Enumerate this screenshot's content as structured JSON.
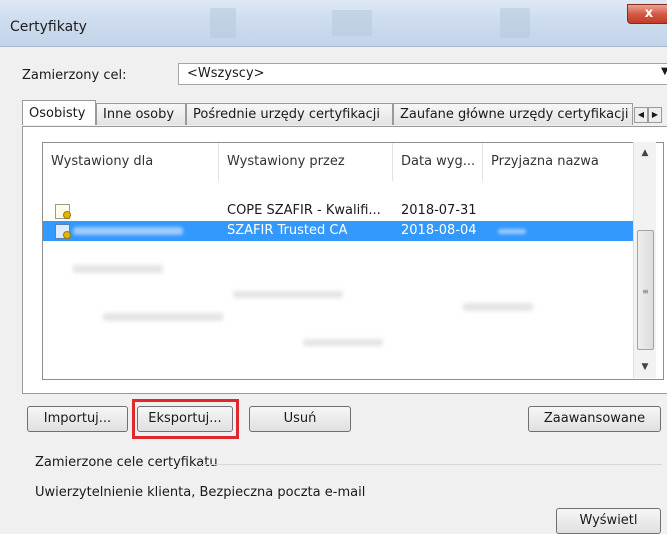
{
  "window": {
    "title": "Certyfikaty",
    "close_glyph": "x"
  },
  "purpose": {
    "label": "Zamierzony cel:",
    "value": "<Wszyscy>"
  },
  "tabs": [
    {
      "label": "Osobisty",
      "active": true
    },
    {
      "label": "Inne osoby",
      "active": false
    },
    {
      "label": "Pośrednie urzędy certyfikacji",
      "active": false
    },
    {
      "label": "Zaufane główne urzędy certyfikacji",
      "active": false
    }
  ],
  "list": {
    "columns": [
      "Wystawiony dla",
      "Wystawiony przez",
      "Data wyg...",
      "Przyjazna nazwa"
    ],
    "rows": [
      {
        "issued_to": "",
        "issued_by": "COPE SZAFIR - Kwalifi...",
        "expiry": "2018-07-31",
        "friendly_name": "",
        "selected": false
      },
      {
        "issued_to": "",
        "issued_by": "SZAFIR Trusted CA",
        "expiry": "2018-08-04",
        "friendly_name": "",
        "selected": true
      }
    ]
  },
  "buttons": {
    "import": "Importuj...",
    "export": "Eksportuj...",
    "remove": "Usuń",
    "advanced": "Zaawansowane",
    "view": "Wyświetl"
  },
  "cert_purposes": {
    "label": "Zamierzone cele certyfikatu",
    "text": "Uwierzytelnienie klienta, Bezpieczna poczta e-mail"
  },
  "colors": {
    "selection": "#3399ff",
    "highlight_box": "#e0272c"
  }
}
